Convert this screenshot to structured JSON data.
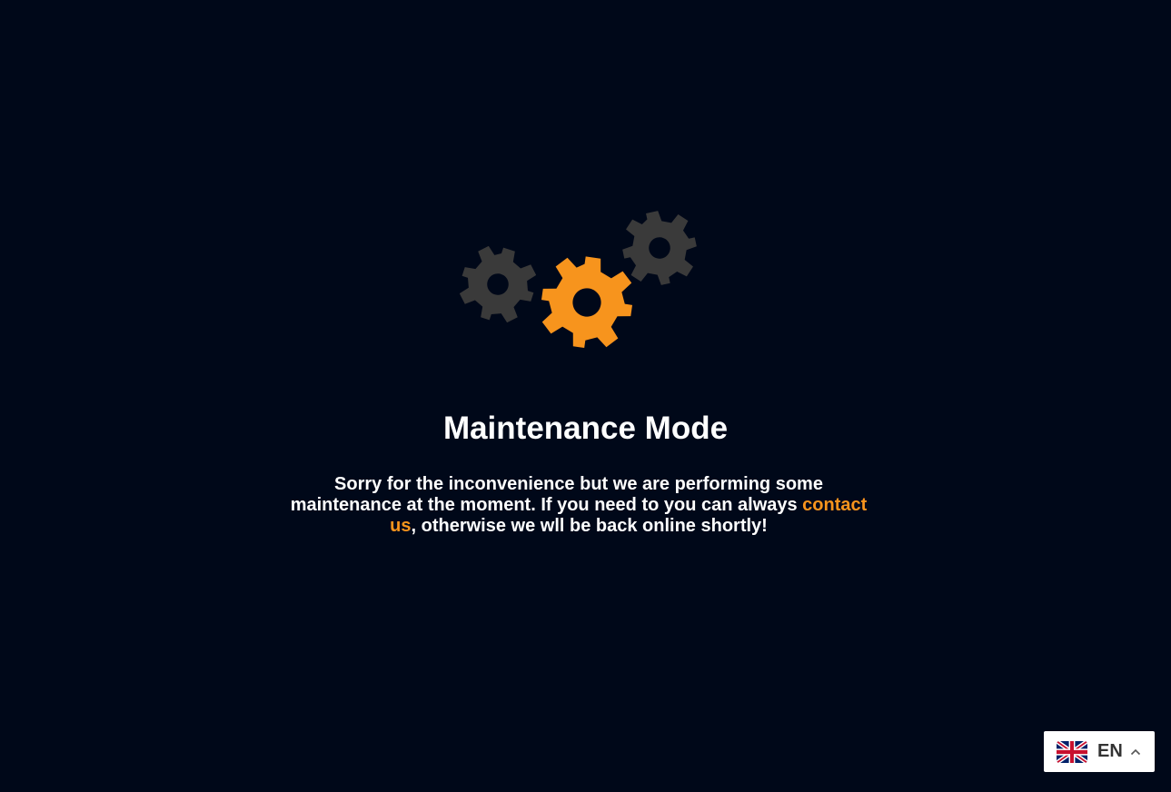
{
  "maintenance": {
    "title": "Maintenance Mode",
    "message_before": "Sorry for the inconvenience but we are performing some maintenance at the moment. If you need to you can always ",
    "contact_link": "contact us",
    "message_after": ", otherwise we wll be back online shortly!"
  },
  "gears": {
    "icons": [
      "gear-icon",
      "gear-icon",
      "gear-icon"
    ],
    "colors": {
      "gray": "#3a3a3a",
      "accent": "#f7941d"
    }
  },
  "language_switcher": {
    "code": "EN",
    "flag": "uk-flag-icon",
    "chevron": "chevron-up-icon"
  },
  "theme": {
    "background": "#000819",
    "text": "#ffffff",
    "accent": "#f7941d"
  }
}
